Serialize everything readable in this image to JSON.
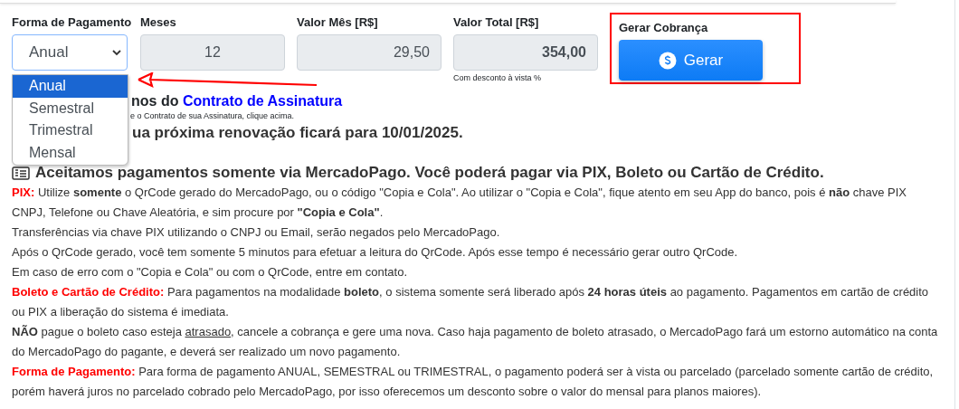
{
  "form": {
    "fields": [
      {
        "kind": "select",
        "label": "Forma de Pagamento",
        "value": "Anual",
        "open": true,
        "options": [
          {
            "label": "Anual",
            "selected": true
          },
          {
            "label": "Semestral",
            "selected": false
          },
          {
            "label": "Trimestral",
            "selected": false
          },
          {
            "label": "Mensal",
            "selected": false
          }
        ]
      },
      {
        "kind": "count",
        "label": "Meses",
        "value": "12",
        "bold": false
      },
      {
        "kind": "money",
        "label": "Valor Mês [R$]",
        "value": "29,50",
        "bold": false
      },
      {
        "kind": "money",
        "label": "Valor Total [R$]",
        "value": "354,00",
        "bold": true,
        "hint": "Com desconto à vista %"
      }
    ],
    "charge": {
      "label": "Gerar Cobrança",
      "button": "Gerar",
      "highlighted": true
    }
  },
  "contract": {
    "text": "nos do",
    "link": "Contrato de Assinatura",
    "note": "e o Contrato de sua Assinatura, clique acima."
  },
  "renewal": "ua próxima renovação ficará para 10/01/2025.",
  "notice": "Aceitamos pagamentos somente via MercadoPago. Você poderá pagar via PIX, Boleto ou Cartão de Crédito.",
  "paragraphs": [
    {
      "title": "PIX:",
      "lines": [
        {
          "text": "Utilize **somente** o QrCode gerado do MercadoPago, ou o código \"Copia e Cola\". Ao utilizar o \"Copia e Cola\", fique atento em seu App do banco, pois é **não** chave PIX CNPJ, Telefone ou Chave Aleatória, e sim procure por **\"Copia e Cola\"**."
        },
        {
          "text": "Transferências via chave PIX utilizando o CNPJ ou Email, serão negados pelo MercadoPago."
        },
        {
          "text": "Após o QrCode gerado, você tem somente 5 minutos para efetuar a leitura do QrCode. Após esse tempo é necessário gerar outro QrCode."
        },
        {
          "text": "Em caso de erro com o \"Copia e Cola\" ou com o QrCode, entre em contato."
        }
      ]
    },
    {
      "title": "Boleto e Cartão de Crédito:",
      "lines": [
        {
          "text": "Para pagamentos na modalidade **boleto**, o sistema somente será liberado após **24 horas úteis** ao pagamento. Pagamentos em cartão de crédito ou PIX a liberação do sistema é imediata."
        },
        {
          "text": "**NÃO** pague o boleto caso esteja ",
          "underline": "atrasado",
          "after": ", cancele a cobrança e gere uma nova. Caso haja pagamento de boleto atrasado, o MercadoPago fará um estorno automático na conta do MercadoPago do pagante, e deverá ser realizado um novo pagamento."
        }
      ]
    },
    {
      "title": "Forma de Pagamento:",
      "lines": [
        {
          "text": "Para forma de pagamento ANUAL, SEMESTRAL ou TRIMESTRAL, o pagamento poderá ser à vista ou parcelado (parcelado somente cartão de crédito, porém haverá juros no parcelado cobrado pelo MercadoPago, por isso oferecemos um desconto sobre o valor do mensal para planos maiores)."
        }
      ]
    }
  ]
}
